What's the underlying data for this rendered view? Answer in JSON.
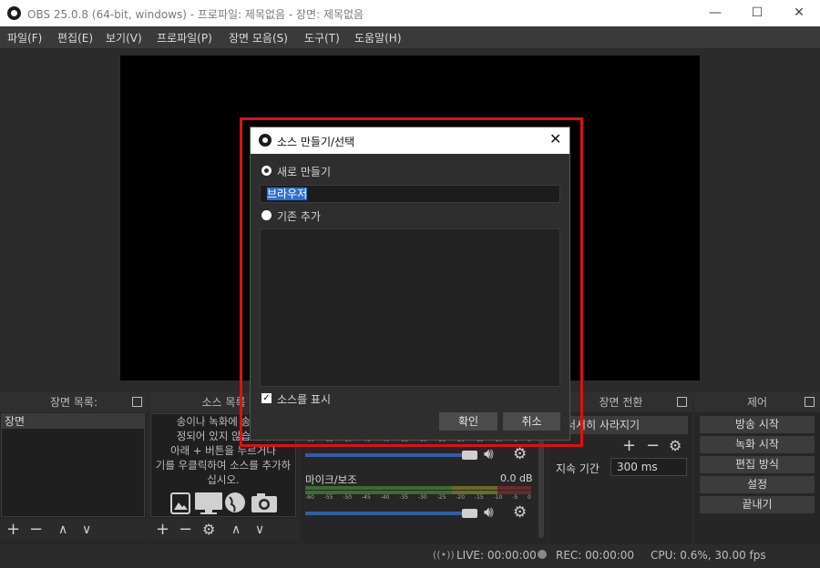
{
  "window": {
    "title": "OBS 25.0.8 (64-bit, windows) - 프로파일: 제목없음 - 장면: 제목없음",
    "minimize": "—",
    "maximize": "☐",
    "close": "✕"
  },
  "menu": [
    "파일(F)",
    "편집(E)",
    "보기(V)",
    "프로파일(P)",
    "장면 모음(S)",
    "도구(T)",
    "도움말(H)"
  ],
  "docks": {
    "scenes": {
      "title": "장면 목록:",
      "items": [
        "장면"
      ]
    },
    "sources": {
      "title": "소스 목록",
      "empty_text": [
        "송이나 녹화에 송출되",
        "정되어 있지 않습니다",
        "아래 + 버튼을 누르거나",
        "기를 우클릭하여 소스를 추가하",
        "십시오."
      ]
    },
    "mixer": {
      "mic_label": "마이크/보조",
      "mic_db": "0.0 dB",
      "scale": [
        "-60",
        "-55",
        "-50",
        "-45",
        "-40",
        "-35",
        "-30",
        "-25",
        "-20",
        "-15",
        "-10",
        "-5",
        "0"
      ]
    },
    "transitions": {
      "title": "장면 전환",
      "selected": "서서히 사라지기",
      "duration_label": "지속 기간",
      "duration_value": "300 ms"
    },
    "controls": {
      "title": "제어",
      "buttons": [
        "방송 시작",
        "녹화 시작",
        "편집 방식",
        "설정",
        "끝내기"
      ]
    }
  },
  "status": {
    "live": "LIVE: 00:00:00",
    "rec": "REC: 00:00:00",
    "cpu": "CPU: 0.6%, 30.00 fps"
  },
  "dialog": {
    "title": "소스 만들기/선택",
    "create_new_label": "새로 만들기",
    "name_value": "브라우저",
    "add_existing_label": "기존 추가",
    "show_source_label": "소스를 표시",
    "ok_label": "확인",
    "cancel_label": "취소"
  },
  "colors": {
    "highlight_box": "#e01010",
    "selection": "#2f6fd3"
  }
}
